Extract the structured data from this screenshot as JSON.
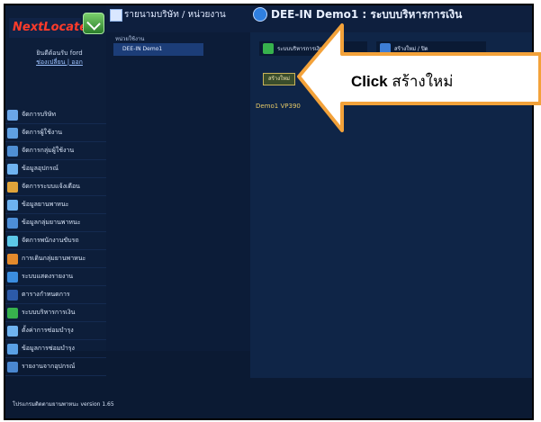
{
  "header": {
    "company_title": "รายนามบริษัท / หน่วยงาน",
    "system_title": "DEE-IN Demo1 : ระบบบริหารการเงิน"
  },
  "sidebar": {
    "logo_text": "NextLocate",
    "welcome_line1": "ยินดีต้อนรับ ford",
    "welcome_line2": "ช่องเปลี่ยน | ออก",
    "items": [
      {
        "label": "จัดการบริษัท",
        "color": "#6aa6e8"
      },
      {
        "label": "จัดการผู้ใช้งาน",
        "color": "#5fa0e2"
      },
      {
        "label": "จัดการกลุ่มผู้ใช้งาน",
        "color": "#4f8fd4"
      },
      {
        "label": "ข้อมูลอุปกรณ์",
        "color": "#6fb3f0"
      },
      {
        "label": "จัดการระบบแจ้งเตือน",
        "color": "#e0a43a"
      },
      {
        "label": "ข้อมูลยานพาหนะ",
        "color": "#6db2ef"
      },
      {
        "label": "ข้อมูลกลุ่มยานพาหนะ",
        "color": "#4d8fd8"
      },
      {
        "label": "จัดการพนักงานขับรถ",
        "color": "#5cc8e8"
      },
      {
        "label": "การเดินกลุ่มยานพาหนะ",
        "color": "#e38a2c"
      },
      {
        "label": "ระบบแสดงรายงาน",
        "color": "#3b8ee0"
      },
      {
        "label": "ตารางกำหนดการ",
        "color": "#2c5aa8"
      },
      {
        "label": "ระบบบริหารการเงิน",
        "color": "#37b24d"
      },
      {
        "label": "ตั้งค่าการซ่อมบำรุง",
        "color": "#6fb3f0"
      },
      {
        "label": "ข้อมูลการซ่อมบำรุง",
        "color": "#5aa0e4"
      },
      {
        "label": "รายงานจากอุปกรณ์",
        "color": "#4a87d0"
      },
      {
        "label": "กล่องข้อความ",
        "color": "#6aa6e8"
      }
    ]
  },
  "company": {
    "caption": "หน่วยใช้งาน",
    "selected": "DEE-IN Demo1"
  },
  "main": {
    "tab_finance": "ระบบบริหารการเงิน",
    "tab_close": "สร้างใหม่ / ปิด",
    "new_button": "สร้างใหม่",
    "list_items": [
      "Demo1 VP390"
    ]
  },
  "footer": {
    "version": "โปรแกรมติดตามยานพาหนะ version 1.65"
  },
  "callout": {
    "bold": "Click",
    "text": " สร้างใหม่"
  }
}
